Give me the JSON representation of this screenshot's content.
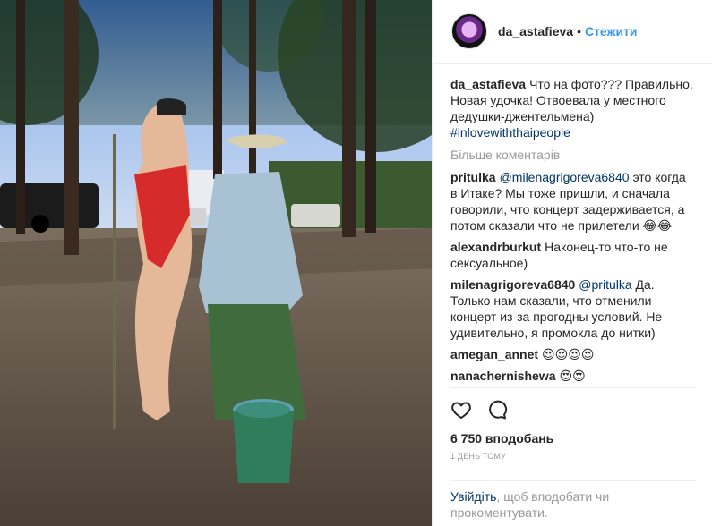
{
  "post": {
    "author": "da_astafieva",
    "follow_label": "Стежити",
    "separator": "•",
    "photo_alt": "Photo"
  },
  "caption": {
    "username": "da_astafieva",
    "text": "Что на фото??? Правильно. Новая удочка! Отвоевала у местного дедушки-джентельмена)",
    "hashtag": "#inlovewiththaipeople"
  },
  "more_comments": "Більше коментарів",
  "comments": [
    {
      "username": "pritulka",
      "mention": "@milenagrigoreva6840",
      "text": "это когда в Итаке? Мы тоже пришли, и сначала говорили, что концерт задерживается, а потом сказали что не прилетели 😂😂"
    },
    {
      "username": "alexandrburkut",
      "mention": "",
      "text": "Наконец-то что-то не сексуальное)"
    },
    {
      "username": "milenagrigoreva6840",
      "mention": "@pritulka",
      "text": "Да. Только нам сказали, что отменили концерт из-за прогодны условий. Не удивительно, я промокла до нитки)"
    },
    {
      "username": "amegan_annet",
      "mention": "",
      "text": "😍😍😍😍"
    },
    {
      "username": "nanachernishewa",
      "mention": "",
      "text": "😍😍"
    }
  ],
  "likes": "6 750 вподобань",
  "time": "1 ДЕНЬ ТОМУ",
  "login": {
    "link": "Увійдіть",
    "text": ", щоб вподобати чи прокоментувати."
  }
}
